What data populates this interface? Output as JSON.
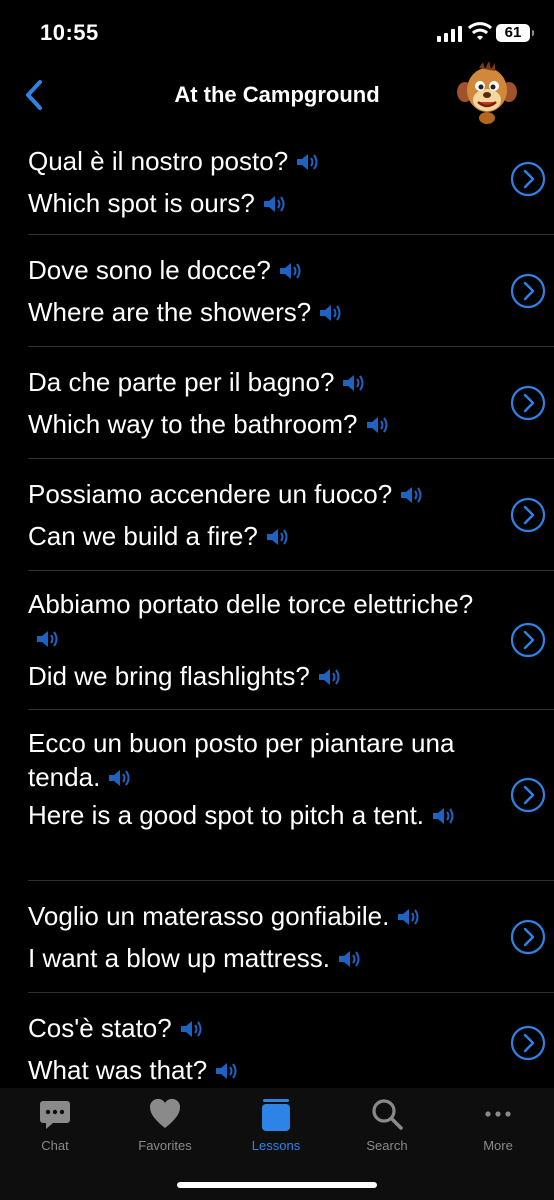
{
  "status": {
    "time": "10:55",
    "battery": "61"
  },
  "nav": {
    "title": "At the Campground"
  },
  "phrases": [
    {
      "it": "Qual è il nostro posto?",
      "en": "Which spot is ours?"
    },
    {
      "it": "Dove sono le docce?",
      "en": "Where are the showers?"
    },
    {
      "it": "Da che parte per il bagno?",
      "en": "Which way to the bathroom?"
    },
    {
      "it": "Possiamo accendere un fuoco?",
      "en": "Can we build a fire?"
    },
    {
      "it": "Abbiamo portato delle torce elettriche?",
      "en": "Did we bring flashlights?"
    },
    {
      "it": "Ecco un buon posto per piantare una tenda.",
      "en": "Here is a good spot to pitch a tent."
    },
    {
      "it": "Voglio un materasso gonfiabile.",
      "en": "I want a blow up mattress."
    },
    {
      "it": "Cos'è stato?",
      "en": "What was that?"
    }
  ],
  "tabs": [
    {
      "label": "Chat",
      "icon": "chat-bubble-icon"
    },
    {
      "label": "Favorites",
      "icon": "heart-icon"
    },
    {
      "label": "Lessons",
      "icon": "lessons-book-icon"
    },
    {
      "label": "Search",
      "icon": "search-icon"
    },
    {
      "label": "More",
      "icon": "ellipsis-icon"
    }
  ],
  "colors": {
    "accent": "#2e84e6",
    "background": "#000000",
    "inactive": "#8a8a8a"
  }
}
